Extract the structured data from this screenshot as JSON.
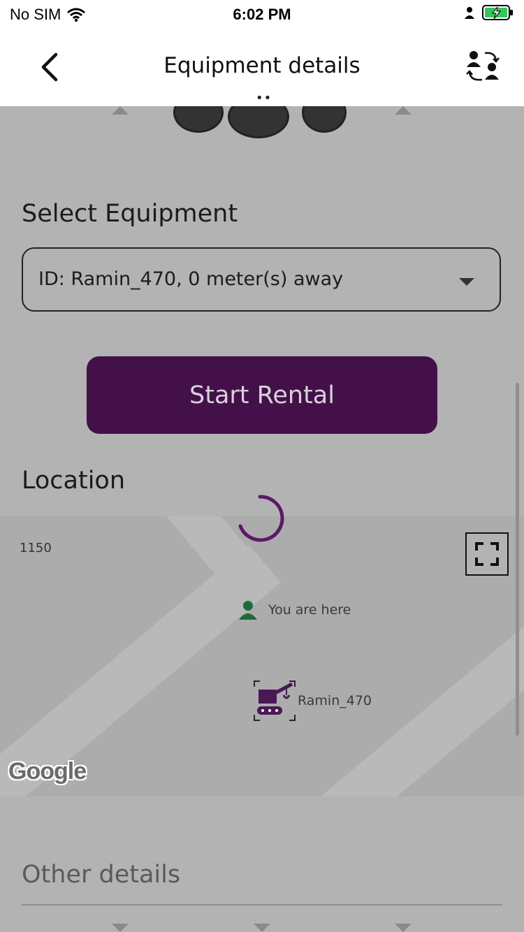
{
  "status_bar": {
    "carrier": "No SIM",
    "time": "6:02 PM"
  },
  "header": {
    "title": "Equipment details",
    "handle": "••"
  },
  "select_equipment": {
    "label": "Select Equipment",
    "selected_value": "ID: Ramin_470, 0 meter(s) away"
  },
  "start_rental": {
    "label": "Start Rental",
    "color": "#43104a"
  },
  "location": {
    "label": "Location",
    "map": {
      "street_number": "1150",
      "you_marker_label": "You are here",
      "equipment_marker_label": "Ramin_470",
      "provider_logo": "Google"
    }
  },
  "other_details": {
    "label": "Other details"
  },
  "colors": {
    "accent": "#43104a",
    "spinner": "#5a1a66",
    "you_marker": "#1f6b3f"
  },
  "icons": {
    "back": "chevron-left-icon",
    "swap_users": "swap-users-icon",
    "dropdown": "caret-down-icon",
    "fullscreen": "fullscreen-icon",
    "person": "person-icon",
    "crane": "crane-icon"
  }
}
